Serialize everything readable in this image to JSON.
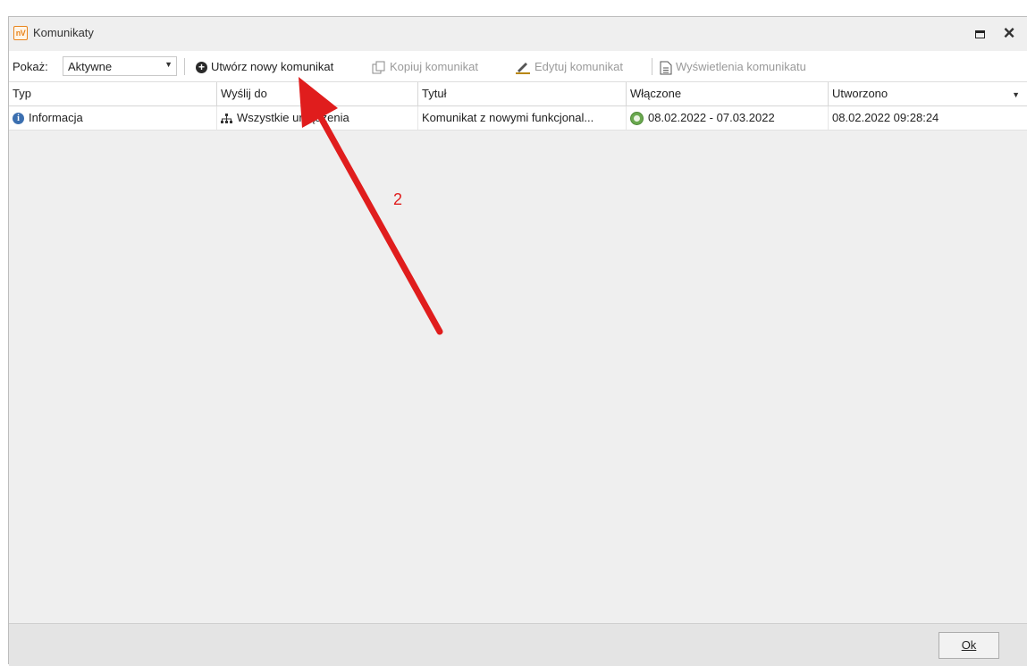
{
  "window": {
    "title": "Komunikaty",
    "logo_text": "nV"
  },
  "toolbar": {
    "show_label": "Pokaż:",
    "show_value": "Aktywne",
    "create_new": "Utwórz nowy komunikat",
    "copy": "Kopiuj komunikat",
    "edit": "Edytuj komunikat",
    "views": "Wyświetlenia komunikatu"
  },
  "grid": {
    "columns": [
      "Typ",
      "Wyślij do",
      "Tytuł",
      "Włączone",
      "Utworzono"
    ],
    "rows": [
      {
        "type": "Informacja",
        "send_to": "Wszystkie urządzenia",
        "title": "Komunikat z nowymi funkcjonal...",
        "enabled": "08.02.2022 - 07.03.2022",
        "created": "08.02.2022 09:28:24"
      }
    ]
  },
  "footer": {
    "ok_label": "Ok"
  },
  "annotation": {
    "number": "2",
    "color": "#e01d1d"
  },
  "colors": {
    "window_bg": "#efefef",
    "info_icon": "#3b6fb0",
    "clock_icon": "#6aa84f"
  }
}
